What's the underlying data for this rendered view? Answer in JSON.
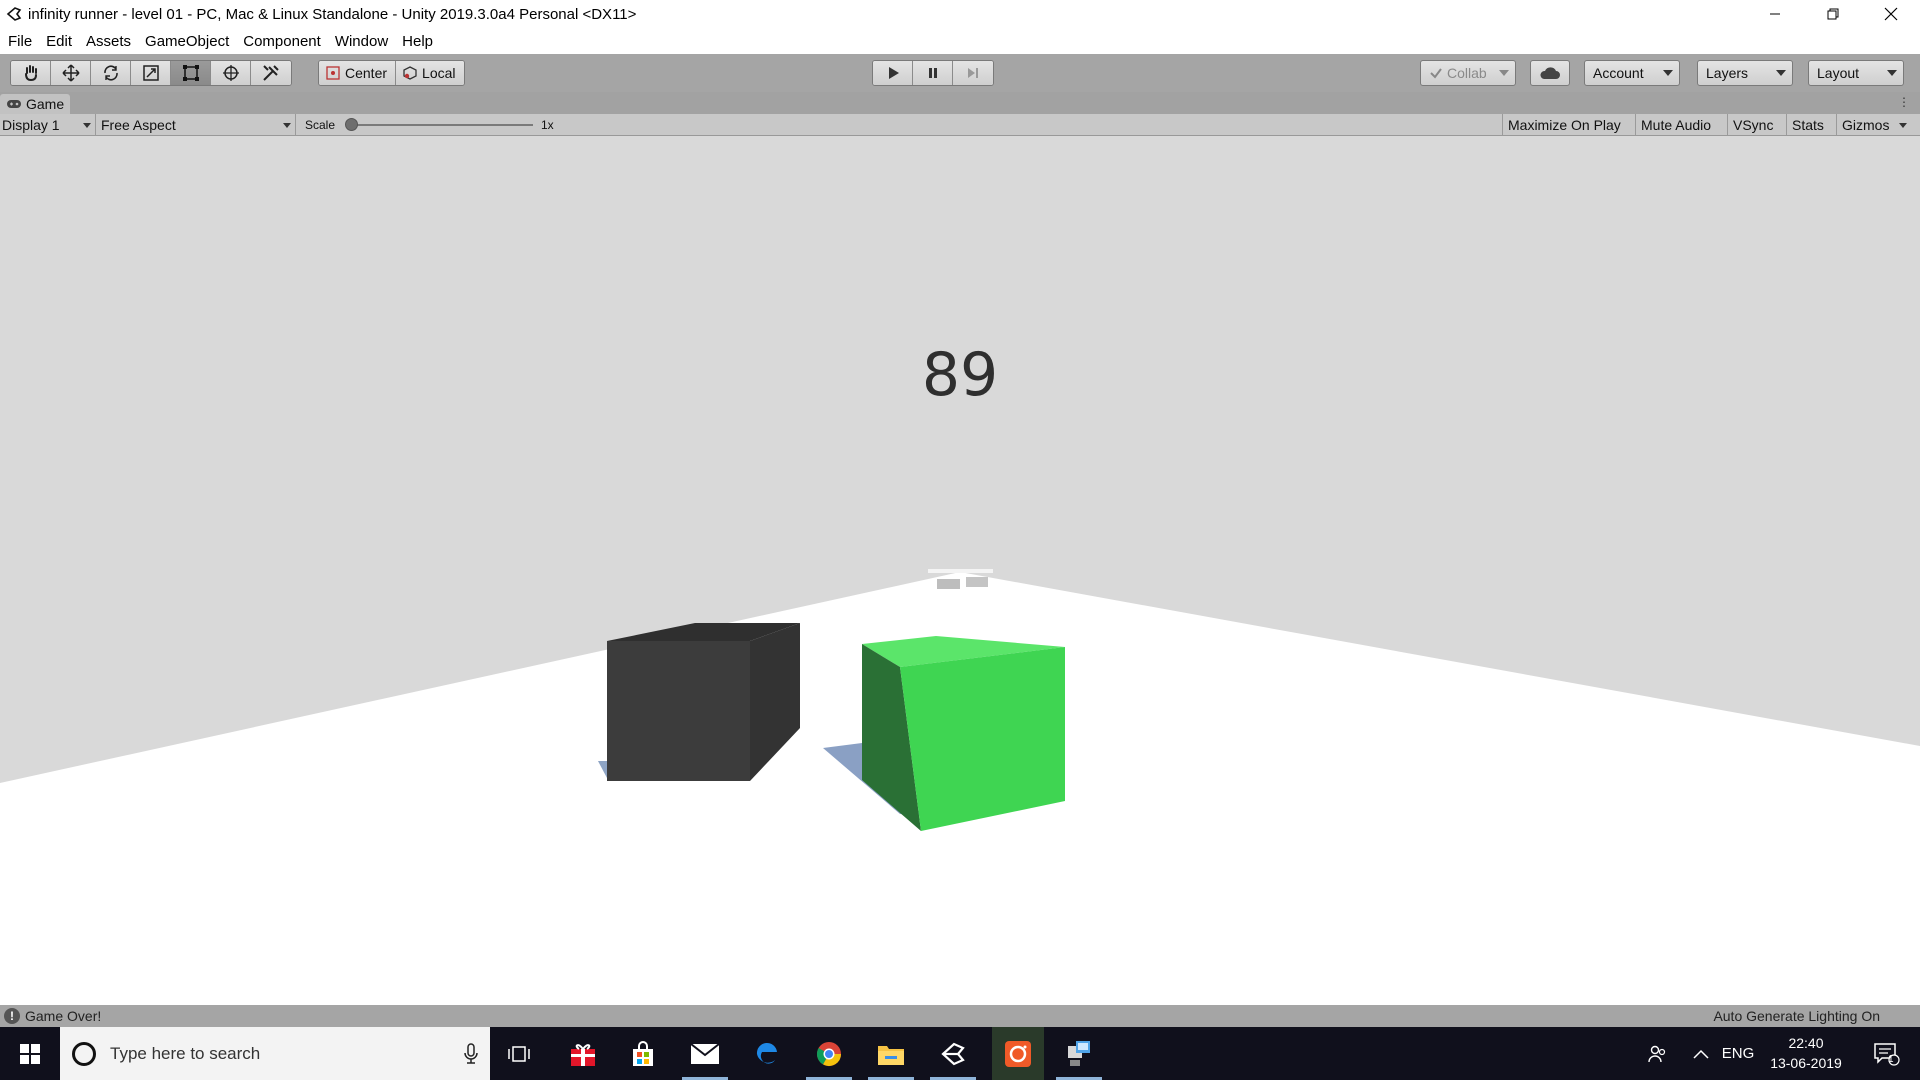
{
  "window": {
    "title": "infinity runner - level 01 - PC, Mac & Linux Standalone - Unity 2019.3.0a4 Personal <DX11>",
    "controls": [
      "minimize-icon",
      "restore-icon",
      "close-icon"
    ]
  },
  "menu": [
    "File",
    "Edit",
    "Assets",
    "GameObject",
    "Component",
    "Window",
    "Help"
  ],
  "toolbar": {
    "transform_tools": [
      "hand-icon",
      "move-icon",
      "rotate-icon",
      "scale-icon",
      "rect-icon",
      "transform-icon",
      "custom-tool-icon"
    ],
    "pivot_center": "Center",
    "pivot_local": "Local",
    "playback": [
      "play-icon",
      "pause-icon",
      "step-icon"
    ],
    "collab": "Collab",
    "account": "Account",
    "layers": "Layers",
    "layout": "Layout"
  },
  "game_panel": {
    "tab_label": "Game",
    "display": "Display 1",
    "aspect": "Free Aspect",
    "scale_label": "Scale",
    "scale_value": "1x",
    "options": [
      "Maximize On Play",
      "Mute Audio",
      "VSync",
      "Stats",
      "Gizmos"
    ]
  },
  "game_view": {
    "score": "89",
    "colors": {
      "sky": "#d9d9d9",
      "ground": "#ffffff",
      "obstacle": "#3c3c3c",
      "player": "#3fd552"
    }
  },
  "status": {
    "message": "Game Over!",
    "lighting": "Auto Generate Lighting On"
  },
  "taskbar": {
    "search_placeholder": "Type here to search",
    "apps": [
      "task-view-icon",
      "gift-icon",
      "store-icon",
      "mail-icon",
      "edge-icon",
      "chrome-icon",
      "file-explorer-icon",
      "unity-icon",
      "camera-app-icon",
      "network-app-icon"
    ],
    "language": "ENG",
    "time": "22:40",
    "date": "13-06-2019",
    "notification_count": "1"
  }
}
